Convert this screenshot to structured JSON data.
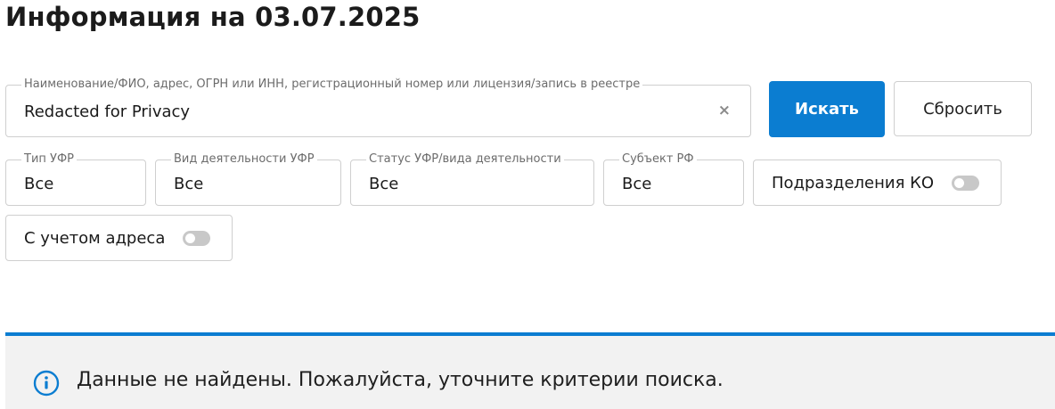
{
  "header": {
    "title": "Информация на 03.07.2025"
  },
  "search": {
    "label": "Наименование/ФИО, адрес, ОГРН или ИНН, регистрационный номер или лицензия/запись в реестре",
    "value": "Redacted for Privacy",
    "clear_glyph": "×",
    "search_label": "Искать",
    "reset_label": "Сбросить"
  },
  "filters": [
    {
      "label": "Тип УФР",
      "value": "Все"
    },
    {
      "label": "Вид деятельности УФР",
      "value": "Все"
    },
    {
      "label": "Статус УФР/вида деятельности",
      "value": "Все"
    },
    {
      "label": "Субъект РФ",
      "value": "Все"
    }
  ],
  "toggles": {
    "ko": {
      "label": "Подразделения КО",
      "on": false
    },
    "address": {
      "label": "С учетом адреса",
      "on": false
    }
  },
  "alert": {
    "icon": "info-icon",
    "text": "Данные не найдены. Пожалуйста, уточните критерии поиска."
  },
  "colors": {
    "accent": "#0b7dd1",
    "border": "#cfcfcf",
    "alert_bg": "#f2f2f2",
    "toggle_off": "#c8c8c8"
  }
}
